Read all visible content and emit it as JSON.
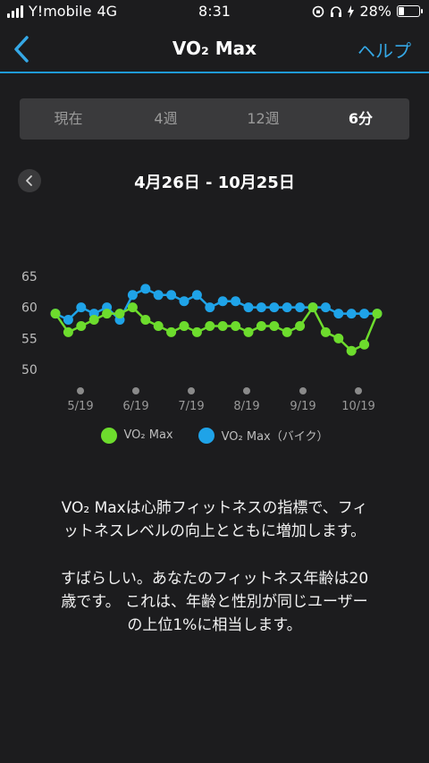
{
  "status_bar": {
    "carrier": "Y!mobile",
    "network": "4G",
    "time": "8:31",
    "battery_text": "28%",
    "battery_level": 0.28
  },
  "nav": {
    "title": "VO₂ Max",
    "help": "ヘルプ"
  },
  "tabs": [
    {
      "label": "現在",
      "active": false
    },
    {
      "label": "4週",
      "active": false
    },
    {
      "label": "12週",
      "active": false
    },
    {
      "label": "6分",
      "active": true
    }
  ],
  "range": {
    "title": "4月26日 - 10月25日"
  },
  "colors": {
    "green": "#6ddc2d",
    "blue": "#1fa3e8",
    "accent": "#1f9ad6"
  },
  "chart_data": {
    "type": "line",
    "x_ticks": [
      "5/19",
      "6/19",
      "7/19",
      "8/19",
      "9/19",
      "10/19"
    ],
    "y_ticks": [
      65,
      60,
      55,
      50
    ],
    "ylim": [
      50,
      65
    ],
    "legend": [
      "VO₂ Max",
      "VO₂ Max（バイク）"
    ],
    "series": [
      {
        "name": "VO₂ Max",
        "color": "#6ddc2d",
        "x": [
          0,
          1,
          2,
          3,
          4,
          5,
          6,
          7,
          8,
          9,
          10,
          11,
          12,
          13,
          14,
          15,
          16,
          17,
          18,
          19,
          20,
          21,
          22,
          23,
          24,
          25
        ],
        "values": [
          59,
          56,
          57,
          58,
          59,
          59,
          60,
          58,
          57,
          56,
          57,
          56,
          57,
          57,
          57,
          56,
          57,
          57,
          56,
          57,
          60,
          56,
          55,
          53,
          54,
          59
        ]
      },
      {
        "name": "VO₂ Max（バイク）",
        "color": "#1fa3e8",
        "x": [
          0,
          1,
          2,
          3,
          4,
          5,
          6,
          7,
          8,
          9,
          10,
          11,
          12,
          13,
          14,
          15,
          16,
          17,
          18,
          19,
          20,
          21,
          22,
          23,
          24,
          25
        ],
        "values": [
          59,
          58,
          60,
          59,
          60,
          58,
          62,
          63,
          62,
          62,
          61,
          62,
          60,
          61,
          61,
          60,
          60,
          60,
          60,
          60,
          60,
          60,
          59,
          59,
          59,
          59
        ]
      }
    ]
  },
  "description": {
    "p1_line1": "VO₂ Maxは心肺フィットネスの指標で、フィ",
    "p1_line2": "ットネスレベルの向上とともに増加します。",
    "p2_line1": "すばらしい。あなたのフィットネス年齢は20",
    "p2_line2": "歳です。 これは、年齢と性別が同じユーザー",
    "p2_line3": "の上位1%に相当します。"
  }
}
